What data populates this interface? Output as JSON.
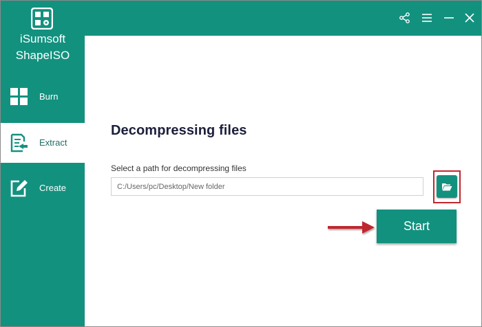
{
  "app": {
    "name_line1": "iSumsoft",
    "name_line2": "ShapeISO"
  },
  "sidebar": {
    "items": [
      {
        "label": "Burn",
        "icon": "grid-icon",
        "active": false
      },
      {
        "label": "Extract",
        "icon": "extract-icon",
        "active": true
      },
      {
        "label": "Create",
        "icon": "edit-icon",
        "active": false
      }
    ]
  },
  "titlebar": {
    "icons": [
      "share-icon",
      "menu-icon",
      "minimize-icon",
      "close-icon"
    ]
  },
  "main": {
    "title": "Decompressing files",
    "path_label": "Select a path for decompressing files",
    "path_value": "C:/Users/pc/Desktop/New folder",
    "browse_icon": "folder-open-icon",
    "start_label": "Start"
  },
  "colors": {
    "accent": "#13917f",
    "highlight": "#c0272d",
    "title_text": "#1c1f3a"
  }
}
